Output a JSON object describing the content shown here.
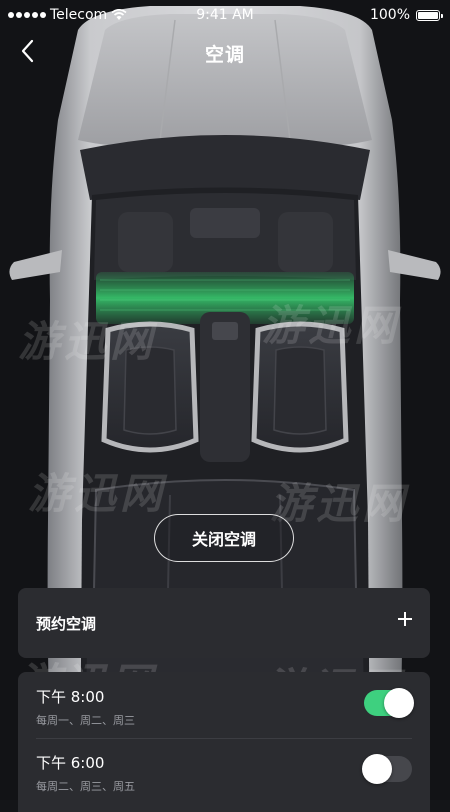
{
  "status_bar": {
    "carrier": "Telecom",
    "time": "9:41 AM",
    "battery": "100%",
    "battery_level": 1.0
  },
  "nav": {
    "title": "空调"
  },
  "watermark": {
    "text": "游迅网"
  },
  "controls": {
    "close_ac_label": "关闭空调"
  },
  "schedule": {
    "title": "预约空调",
    "items": [
      {
        "time": "下午 8:00",
        "days": "每周一、周二、周三",
        "enabled": true
      },
      {
        "time": "下午 6:00",
        "days": "每周二、周三、周五",
        "enabled": false
      }
    ]
  },
  "colors": {
    "accent": "#3ed07f",
    "card": "#2b2c30",
    "airflow": "#38c96e"
  },
  "icons": {
    "back": "chevron-left-icon",
    "add": "plus-icon",
    "wifi": "wifi-icon",
    "signal": "signal-dots-icon",
    "battery": "battery-icon"
  }
}
